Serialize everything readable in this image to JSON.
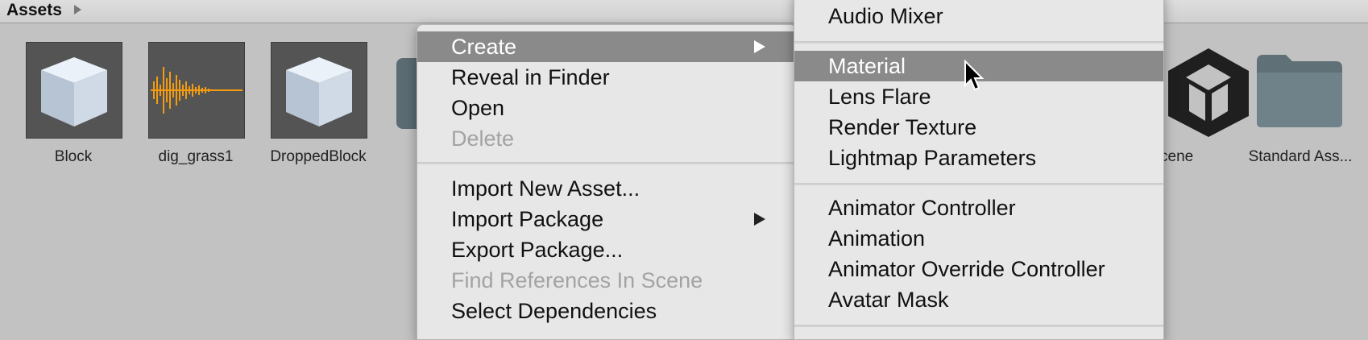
{
  "breadcrumb": {
    "root": "Assets"
  },
  "assets": [
    {
      "name": "Block",
      "icon": "cube-icon"
    },
    {
      "name": "dig_grass1",
      "icon": "audio-waveform-icon"
    },
    {
      "name": "DroppedBlock",
      "icon": "cube-icon"
    },
    {
      "name": "cene",
      "icon": "unity-scene-icon"
    },
    {
      "name": "Standard Ass...",
      "icon": "folder-icon"
    }
  ],
  "context_menu": {
    "items": [
      {
        "label": "Create",
        "state": "highlighted",
        "submenu": true
      },
      {
        "label": "Reveal in Finder"
      },
      {
        "label": "Open"
      },
      {
        "label": "Delete",
        "state": "disabled"
      },
      {
        "label": "Import New Asset..."
      },
      {
        "label": "Import Package",
        "submenu": true
      },
      {
        "label": "Export Package..."
      },
      {
        "label": "Find References In Scene",
        "state": "disabled"
      },
      {
        "label": "Select Dependencies"
      }
    ]
  },
  "create_submenu": {
    "items": [
      {
        "label": "Audio Mixer"
      },
      {
        "label": "Material",
        "state": "highlighted"
      },
      {
        "label": "Lens Flare"
      },
      {
        "label": "Render Texture"
      },
      {
        "label": "Lightmap Parameters"
      },
      {
        "label": "Animator Controller"
      },
      {
        "label": "Animation"
      },
      {
        "label": "Animator Override Controller"
      },
      {
        "label": "Avatar Mask"
      }
    ]
  },
  "colors": {
    "highlight": "#8a8a8a",
    "menu_bg": "#e7e7e7",
    "waveform": "#f39c12",
    "disabled_text": "#a3a3a3"
  }
}
